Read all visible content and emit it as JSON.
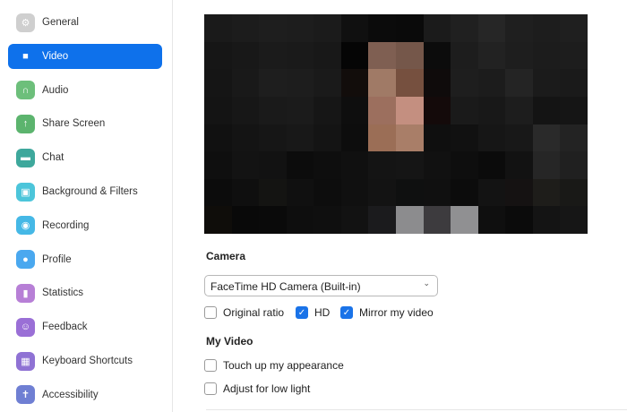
{
  "sidebar": {
    "items": [
      {
        "label": "General",
        "icon": "gear-icon",
        "color": "#cfcfcf"
      },
      {
        "label": "Video",
        "icon": "video-camera-icon",
        "color": "#0e71eb",
        "selected": true
      },
      {
        "label": "Audio",
        "icon": "headphones-icon",
        "color": "#6dbf7b"
      },
      {
        "label": "Share Screen",
        "icon": "share-screen-icon",
        "color": "#5cb46e"
      },
      {
        "label": "Chat",
        "icon": "chat-bubble-icon",
        "color": "#3ea89c"
      },
      {
        "label": "Background & Filters",
        "icon": "background-icon",
        "color": "#4cc5da"
      },
      {
        "label": "Recording",
        "icon": "record-icon",
        "color": "#45b8e6"
      },
      {
        "label": "Profile",
        "icon": "user-icon",
        "color": "#4aa8ef"
      },
      {
        "label": "Statistics",
        "icon": "bar-chart-icon",
        "color": "#b77fd6"
      },
      {
        "label": "Feedback",
        "icon": "smiley-icon",
        "color": "#9a6fd6"
      },
      {
        "label": "Keyboard Shortcuts",
        "icon": "keyboard-icon",
        "color": "#8f72d4"
      },
      {
        "label": "Accessibility",
        "icon": "accessibility-icon",
        "color": "#6f7fd3"
      }
    ]
  },
  "camera": {
    "heading": "Camera",
    "selected": "FaceTime HD Camera (Built-in)",
    "options": [
      {
        "label": "Original ratio",
        "checked": false
      },
      {
        "label": "HD",
        "checked": true
      },
      {
        "label": "Mirror my video",
        "checked": true
      }
    ]
  },
  "my_video": {
    "heading": "My Video",
    "options": [
      {
        "label": "Touch up my appearance",
        "checked": false
      },
      {
        "label": "Adjust for low light",
        "checked": false
      }
    ]
  }
}
